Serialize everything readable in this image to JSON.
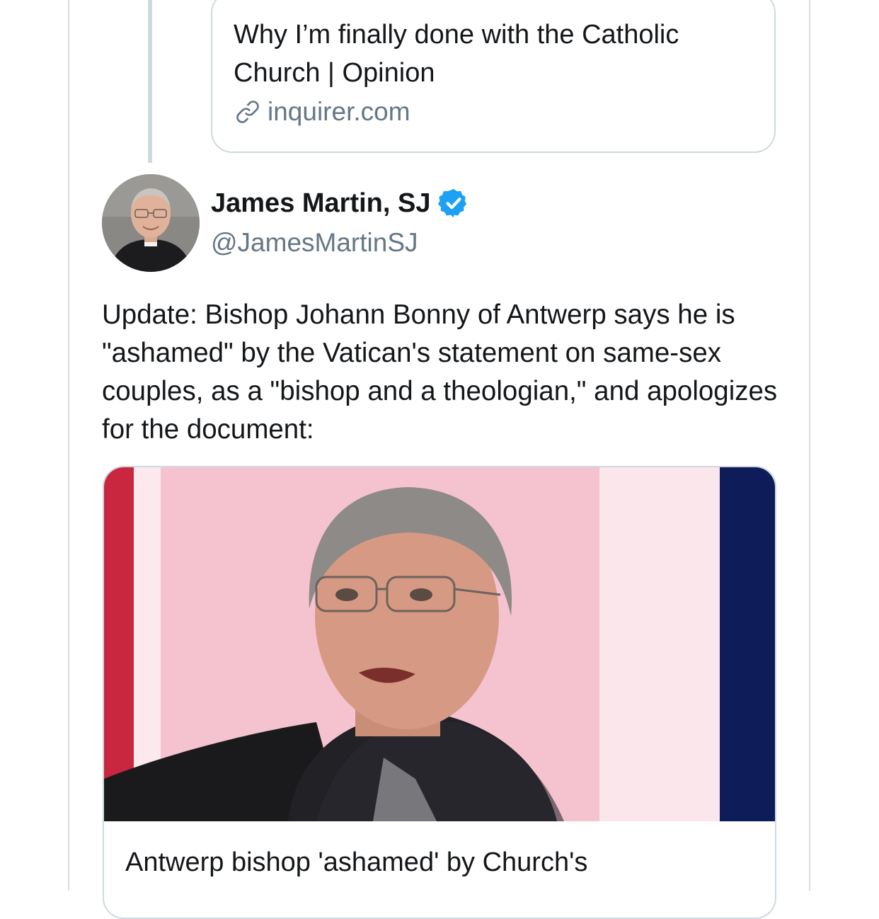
{
  "quoted_card": {
    "title": "Why I’m finally done with the Catholic Church | Opinion",
    "domain": "inquirer.com",
    "link_icon": "link-icon"
  },
  "tweet": {
    "author": {
      "display_name": "James Martin, SJ",
      "handle": "@JamesMartinSJ",
      "verified_icon": "verified-icon",
      "avatar": "avatar"
    },
    "text": "Update: Bishop Johann Bonny of Antwerp says he is \"ashamed\" by the Vatican's statement on same-sex couples, as a \"bishop and a theologian,\" and apologizes for the document:",
    "media_card": {
      "caption": "Antwerp bishop 'ashamed' by Church's"
    }
  },
  "colors": {
    "text": "#14171a",
    "secondary_text": "#657786",
    "border": "#cfd9de",
    "verified": "#1da1f2"
  }
}
